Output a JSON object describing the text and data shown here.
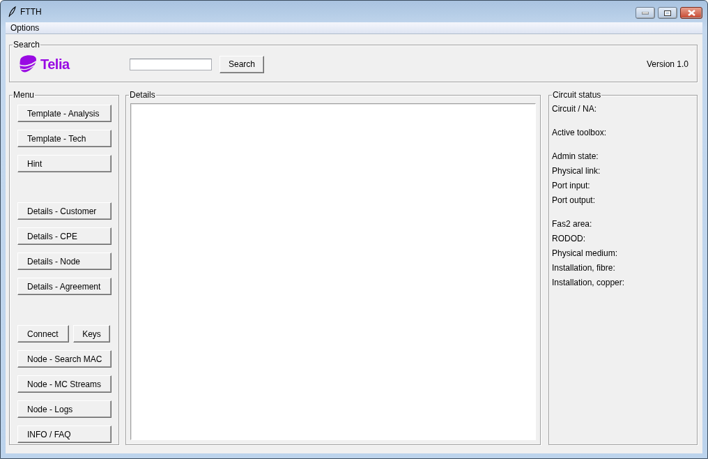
{
  "window": {
    "title": "FTTH"
  },
  "menubar": [
    "Options"
  ],
  "search_group": {
    "title": "Search",
    "logo_text": "Telia",
    "search_button": "Search",
    "version": "Version 1.0"
  },
  "menu": {
    "title": "Menu",
    "groups": [
      {
        "rows": [
          [
            "Template - Analysis"
          ],
          [
            "Template - Tech"
          ],
          [
            "Hint"
          ]
        ]
      },
      {
        "rows": [
          [
            "Details - Customer"
          ],
          [
            "Details - CPE"
          ],
          [
            "Details - Node"
          ],
          [
            "Details - Agreement"
          ]
        ]
      },
      {
        "rows": [
          [
            "Connect",
            "Keys"
          ],
          [
            "Node - Search MAC"
          ],
          [
            "Node - MC Streams"
          ],
          [
            "Node - Logs"
          ],
          [
            "INFO / FAQ"
          ]
        ]
      }
    ]
  },
  "details": {
    "title": "Details"
  },
  "circuit_status": {
    "title": "Circuit status",
    "groups": [
      [
        "Circuit / NA:"
      ],
      [
        "Active toolbox:"
      ],
      [
        "Admin state:",
        "Physical link:",
        "Port input:",
        "Port output:"
      ],
      [
        "Fas2 area:",
        "RODOD:",
        "Physical medium:",
        "Installation, fibre:",
        "Installation, copper:"
      ]
    ]
  }
}
